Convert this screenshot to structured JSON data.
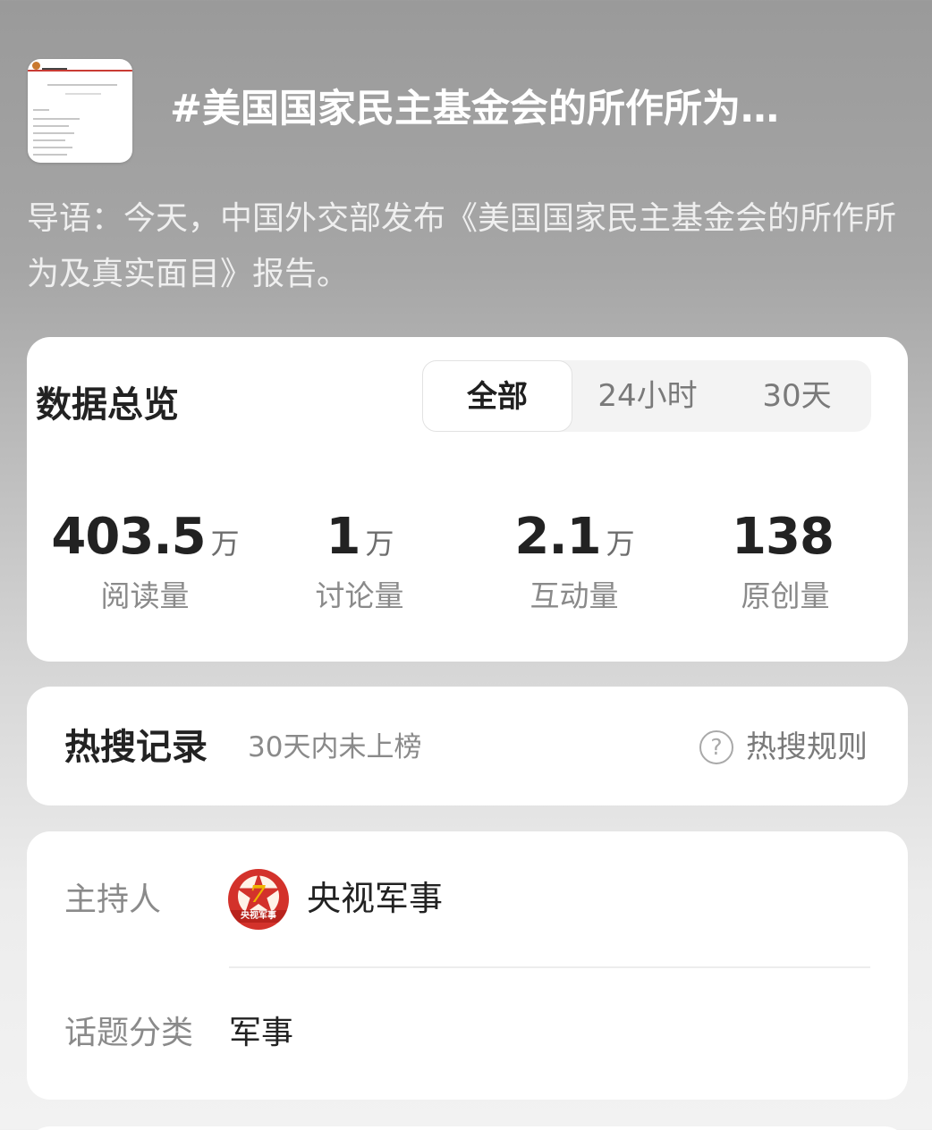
{
  "topic": {
    "title": "#美国国家民主基金会的所作所为…",
    "intro": "导语：今天，中国外交部发布《美国国家民主基金会的所作所为及真实面目》报告。"
  },
  "overview": {
    "title": "数据总览",
    "tabs": [
      {
        "label": "全部",
        "active": true
      },
      {
        "label": "24小时",
        "active": false
      },
      {
        "label": "30天",
        "active": false
      }
    ],
    "stats": [
      {
        "value": "403.5",
        "unit": "万",
        "label": "阅读量"
      },
      {
        "value": "1",
        "unit": "万",
        "label": "讨论量"
      },
      {
        "value": "2.1",
        "unit": "万",
        "label": "互动量"
      },
      {
        "value": "138",
        "unit": "",
        "label": "原创量"
      }
    ]
  },
  "hot_search": {
    "title": "热搜记录",
    "status": "30天内未上榜",
    "rules_icon": "help-circle-icon",
    "rules_label": "热搜规则"
  },
  "info": {
    "host_label": "主持人",
    "host_name": "央视军事",
    "host_avatar_text": "央视军事",
    "category_label": "话题分类",
    "category_value": "军事"
  },
  "colors": {
    "card_bg": "#ffffff",
    "title_text": "#ffffff",
    "primary_text": "#222222",
    "secondary_text": "#8a8a8a",
    "avatar_red": "#d3322b"
  }
}
